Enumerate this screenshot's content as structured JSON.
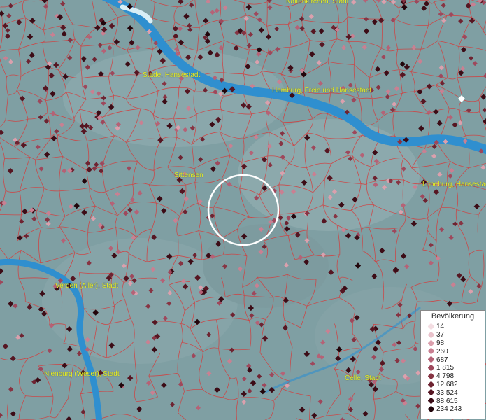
{
  "map": {
    "labels": {
      "kaltenkirchen": "Kaltenkirchen, Stadt",
      "stade": "Stade, Hansestadt",
      "hamburg": "Hamburg, Freie und Hansestadt",
      "sittensen": "Sittensen",
      "lueneburg": "Lüneburg, Hansestadt",
      "verden": "Verden (Aller), Stadt",
      "nienburg": "Nienburg (Weser), Stadt",
      "celle": "Celle, Stadt"
    },
    "colors": {
      "terrain": "#7f9fa3",
      "river": "#2f8fcf",
      "boundary": "#d63a3a",
      "label": "#eaf02a"
    }
  },
  "legend": {
    "title": "Bevölkerung",
    "classes": [
      {
        "label": "14",
        "color": "#f3dde2"
      },
      {
        "label": "37",
        "color": "#e9c2cb"
      },
      {
        "label": "98",
        "color": "#dba0ad"
      },
      {
        "label": "260",
        "color": "#c98092"
      },
      {
        "label": "687",
        "color": "#b56276"
      },
      {
        "label": "1 815",
        "color": "#9e485c"
      },
      {
        "label": "4 798",
        "color": "#873443"
      },
      {
        "label": "12 682",
        "color": "#6e2331"
      },
      {
        "label": "33 524",
        "color": "#561622"
      },
      {
        "label": "88 615",
        "color": "#3c0c16"
      },
      {
        "label": "234 243",
        "color": "#22050b",
        "plus": "+"
      }
    ]
  }
}
